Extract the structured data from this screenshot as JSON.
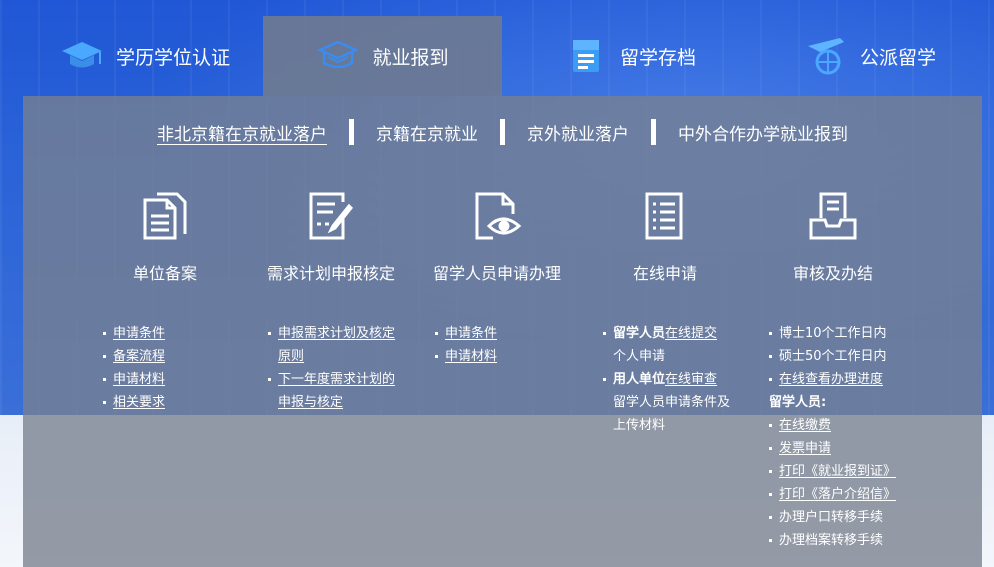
{
  "tabs": [
    {
      "label": "学历学位认证",
      "icon": "graduation-cap-icon"
    },
    {
      "label": "就业报到",
      "icon": "layered-cap-icon",
      "active": true
    },
    {
      "label": "留学存档",
      "icon": "folder-document-icon"
    },
    {
      "label": "公派留学",
      "icon": "airplane-globe-icon"
    }
  ],
  "subnav": [
    "非北京籍在京就业落户",
    "京籍在京就业",
    "京外就业落户",
    "中外合作办学就业报到"
  ],
  "steps": [
    {
      "title": "单位备案",
      "icon": "documents-icon"
    },
    {
      "title": "需求计划申报核定",
      "icon": "form-edit-icon"
    },
    {
      "title": "留学人员申请办理",
      "icon": "document-eye-icon"
    },
    {
      "title": "在线申请",
      "icon": "checklist-icon"
    },
    {
      "title": "审核及办结",
      "icon": "inbox-tray-icon"
    }
  ],
  "col1": [
    "申请条件",
    "备案流程",
    "申请材料",
    "相关要求"
  ],
  "col2": [
    "申报需求计划及核定",
    "原则",
    "下一年度需求计划的",
    "申报与核定"
  ],
  "col3": [
    "申请条件",
    "申请材料"
  ],
  "col4": {
    "a_bold": "留学人员",
    "a_link": "在线提交",
    "a_line2": "个人申请",
    "b_bold": "用人单位",
    "b_link": "在线审查",
    "b_line2": "留学人员申请条件及",
    "b_line3": "上传材料"
  },
  "col5": {
    "l1": "博士10个工作日内",
    "l2": "硕士50个工作日内",
    "l3": "在线查看办理进度",
    "heading": "留学人员:",
    "l4": "在线缴费",
    "l5": "发票申请",
    "l6": "打印《就业报到证》",
    "l7": "打印《落户介绍信》",
    "l8": "办理户口转移手续",
    "l9": "办理档案转移手续"
  }
}
